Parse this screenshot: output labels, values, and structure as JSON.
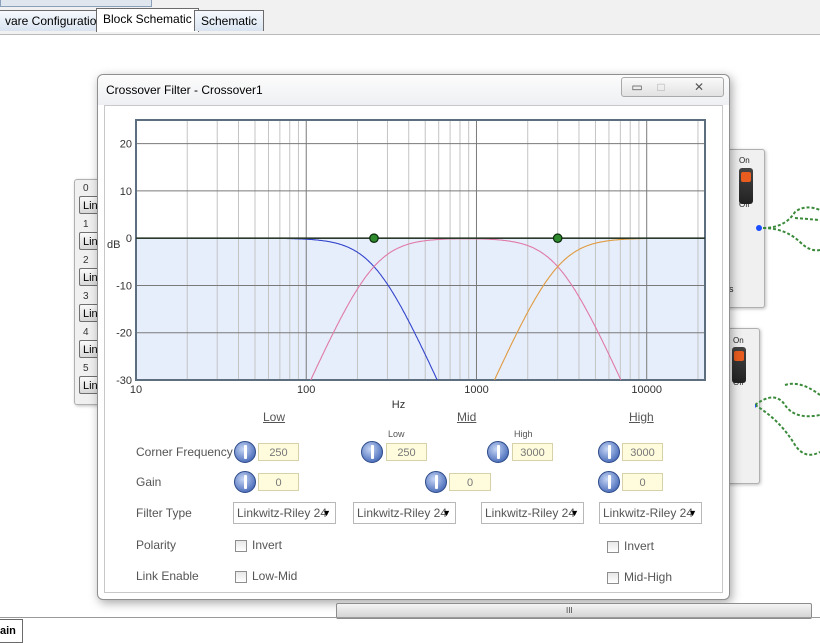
{
  "top_tabs": [
    {
      "label": "vare Configuration",
      "active": false
    },
    {
      "label": "Block Schematic",
      "active": true
    },
    {
      "label": "Schematic",
      "active": false
    }
  ],
  "left_panel": {
    "channels": [
      {
        "num": "0",
        "btn": "Lin"
      },
      {
        "num": "1",
        "btn": "Lin"
      },
      {
        "num": "2",
        "btn": "Lin"
      },
      {
        "num": "3",
        "btn": "Lin"
      },
      {
        "num": "4",
        "btn": "Lin"
      },
      {
        "num": "5",
        "btn": "Lin"
      }
    ]
  },
  "right_panels": {
    "on_label": "On",
    "off_label": "Off",
    "partial_text": "s"
  },
  "window": {
    "title": "Crossover Filter - Crossover1",
    "minimize_glyph": "▭",
    "maximize_glyph": "□",
    "close_glyph": "✕"
  },
  "chart_data": {
    "type": "line",
    "xlabel": "Hz",
    "ylabel": "dB",
    "x_scale": "log",
    "xlim": [
      10,
      22000
    ],
    "ylim": [
      -30,
      25
    ],
    "x_ticks": [
      {
        "value": 10,
        "label": "10"
      },
      {
        "value": 100,
        "label": "100"
      },
      {
        "value": 1000,
        "label": "1000"
      },
      {
        "value": 10000,
        "label": "10000"
      }
    ],
    "y_ticks": [
      {
        "value": 20,
        "label": "20"
      },
      {
        "value": 10,
        "label": "10"
      },
      {
        "value": 0,
        "label": "0"
      },
      {
        "value": -10,
        "label": "-10"
      },
      {
        "value": -20,
        "label": "-20"
      },
      {
        "value": -30,
        "label": "-30"
      }
    ],
    "grid": true,
    "crossover_points": [
      250,
      3000
    ],
    "series": [
      {
        "band": "low",
        "filter": "lowpass",
        "corner_hz": 250,
        "order": 4,
        "color": "#3344cc"
      },
      {
        "band": "mid",
        "filter": "bandpass",
        "low_hz": 250,
        "high_hz": 3000,
        "order": 4,
        "color": "#e07aa8"
      },
      {
        "band": "high",
        "filter": "highpass",
        "corner_hz": 3000,
        "order": 4,
        "color": "#e09a40"
      }
    ],
    "sum_color": "#2a3a2a",
    "fill_color": "#e6eefb"
  },
  "form": {
    "bands": {
      "low": "Low",
      "mid": "Mid",
      "high": "High"
    },
    "rows": {
      "corner_frequency": "Corner Frequency",
      "gain": "Gain",
      "filter_type": "Filter Type",
      "polarity": "Polarity",
      "link_enable": "Link Enable"
    },
    "mid_sublabels": {
      "low": "Low",
      "high": "High"
    },
    "values": {
      "low_corner": "250",
      "mid_low_corner": "250",
      "mid_high_corner": "3000",
      "high_corner": "3000",
      "low_gain": "0",
      "mid_gain": "0",
      "high_gain": "0"
    },
    "filter_types": [
      "Linkwitz-Riley 24",
      "Linkwitz-Riley 24",
      "Linkwitz-Riley 24",
      "Linkwitz-Riley 24"
    ],
    "invert_label": "Invert",
    "link_low_mid": "Low-Mid",
    "link_mid_high": "Mid-High"
  },
  "scrollbar": {
    "grip": "III"
  },
  "bottom_tab": {
    "label": "ain"
  }
}
